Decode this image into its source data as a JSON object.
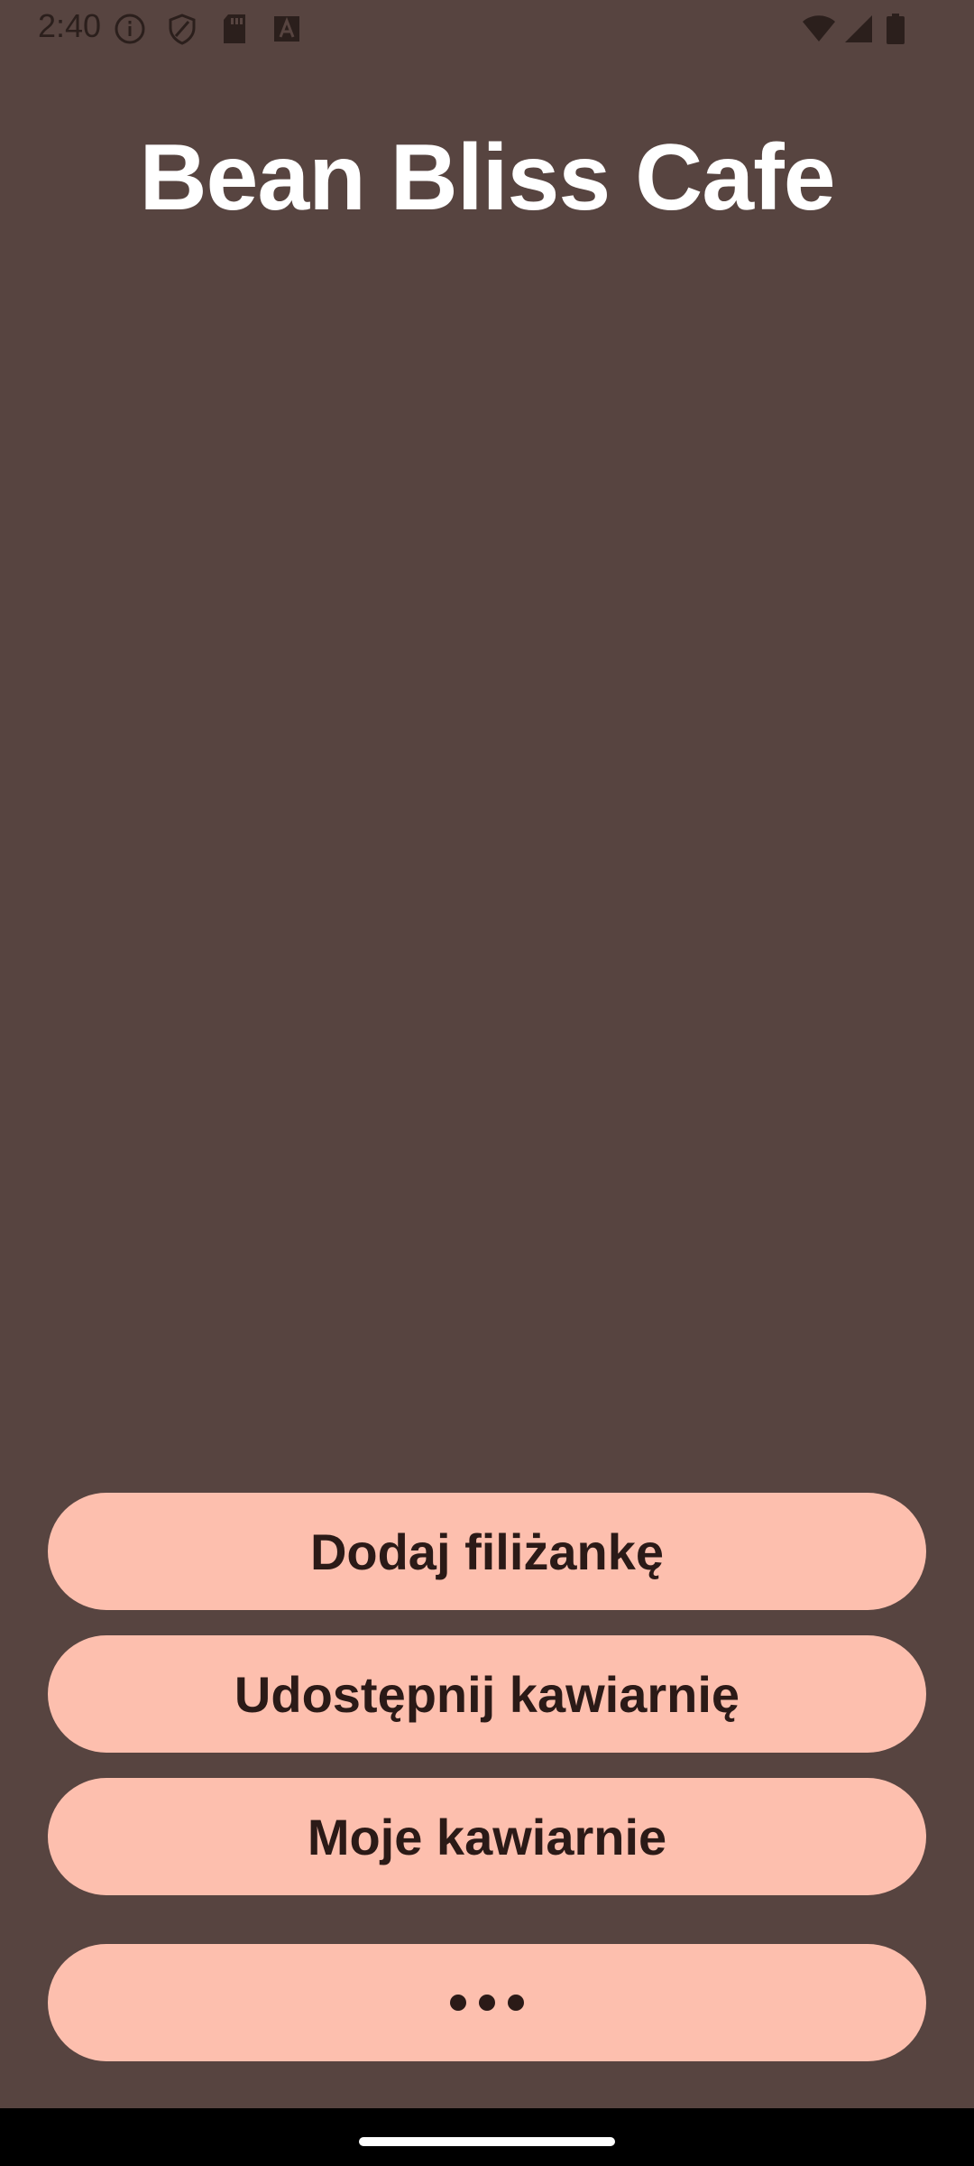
{
  "status_bar": {
    "time": "2:40",
    "left_icons": [
      "info-icon",
      "shield-icon",
      "sd-card-icon",
      "font-a-icon"
    ],
    "right_icons": [
      "wifi-icon",
      "cell-signal-icon",
      "battery-icon"
    ]
  },
  "app": {
    "title": "Bean Bliss Cafe"
  },
  "actions": {
    "add_cup": "Dodaj filiżankę",
    "share_cafe": "Udostępnij kawiarnię",
    "my_cafes": "Moje kawiarnie",
    "more_icon": "more-horizontal-icon"
  },
  "colors": {
    "background": "#574440",
    "button": "#fdbfae",
    "button_text": "#2b1a17",
    "title": "#ffffff"
  }
}
